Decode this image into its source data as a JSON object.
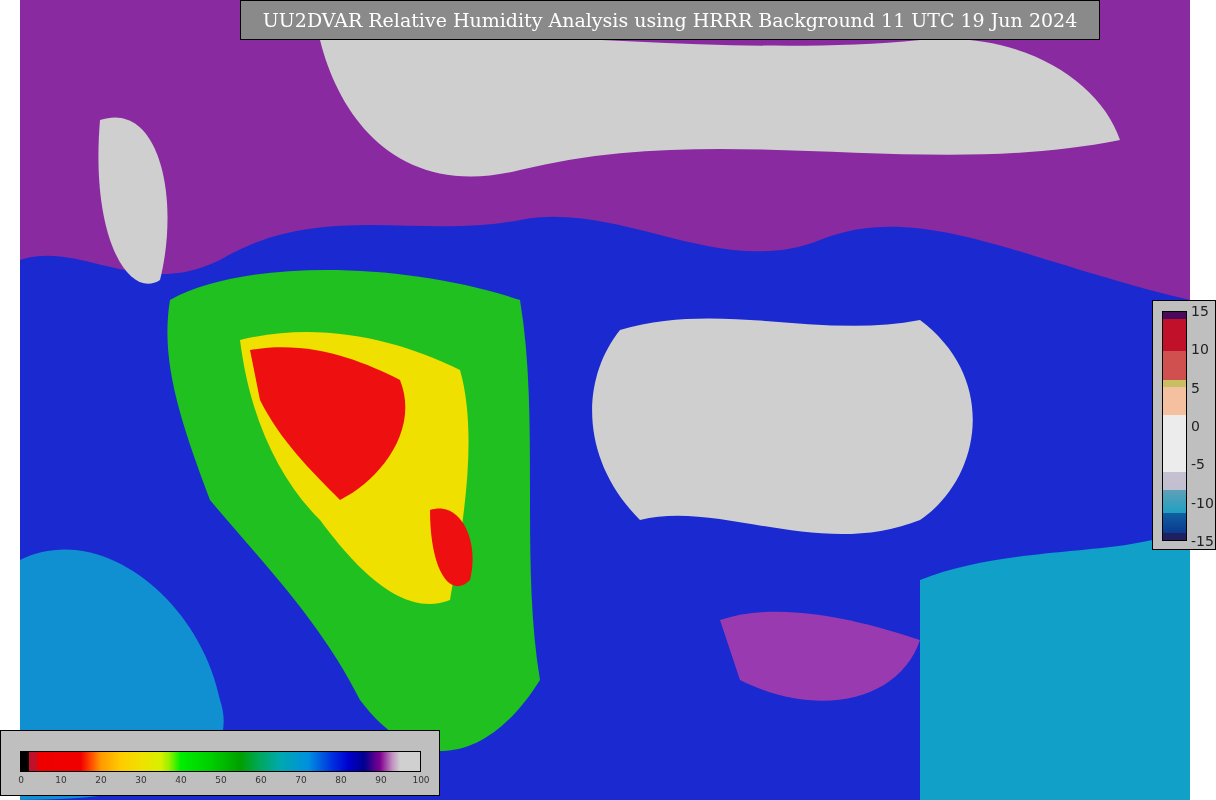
{
  "title": "UU2DVAR Relative Humidity Analysis using HRRR Background 11 UTC 19 Jun 2024",
  "humidity_legend": {
    "ticks": [
      "0",
      "10",
      "20",
      "30",
      "40",
      "50",
      "60",
      "70",
      "80",
      "90",
      "100"
    ]
  },
  "difference_legend": {
    "ticks": [
      "15",
      "10",
      "5",
      "0",
      "-5",
      "-10",
      "-15"
    ]
  }
}
